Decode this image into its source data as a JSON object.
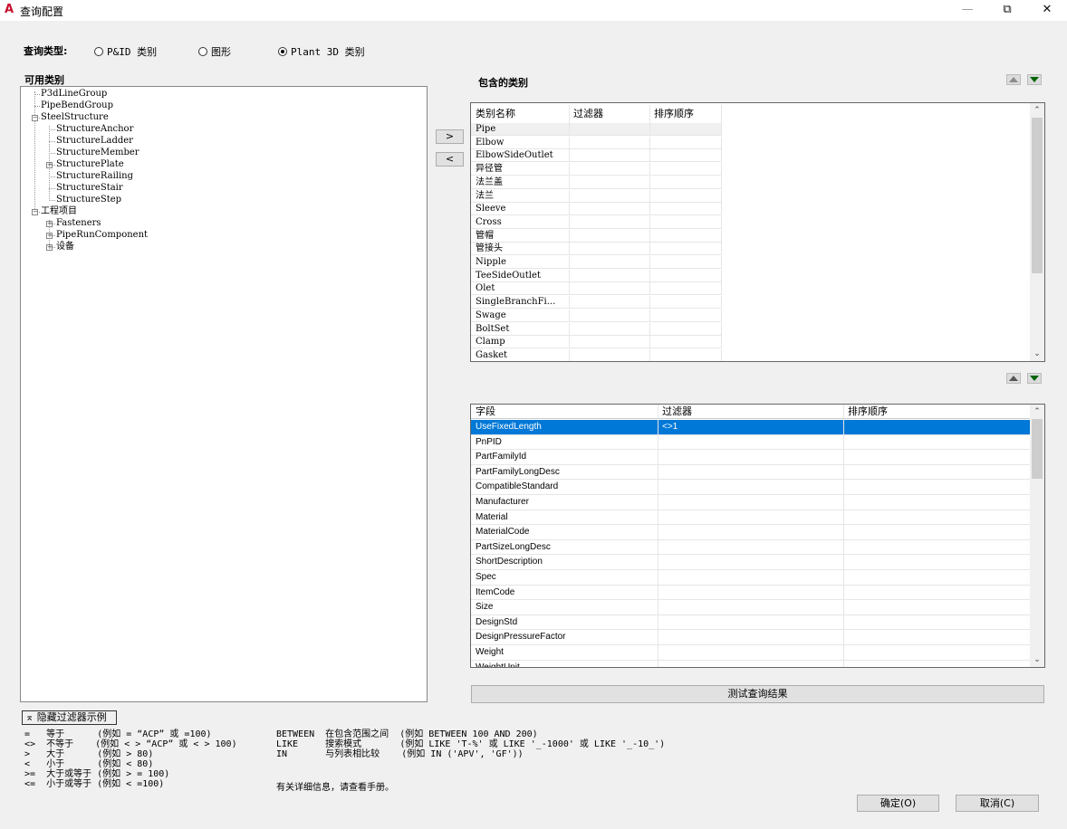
{
  "window": {
    "title": "查询配置",
    "app_icon": "A",
    "min_glyph": "—",
    "max_glyph": "⧉",
    "close_glyph": "✕"
  },
  "query_type": {
    "label": "查询类型:",
    "options": [
      {
        "label": "P&ID 类别",
        "selected": false
      },
      {
        "label": "图形",
        "selected": false
      },
      {
        "label": "Plant 3D 类别",
        "selected": true
      }
    ]
  },
  "available": {
    "title": "可用类别",
    "tree": [
      {
        "label": "P3dLineGroup",
        "level": 0,
        "expander": ""
      },
      {
        "label": "PipeBendGroup",
        "level": 0,
        "expander": ""
      },
      {
        "label": "SteelStructure",
        "level": 0,
        "expander": "−"
      },
      {
        "label": "StructureAnchor",
        "level": 1,
        "expander": ""
      },
      {
        "label": "StructureLadder",
        "level": 1,
        "expander": ""
      },
      {
        "label": "StructureMember",
        "level": 1,
        "expander": ""
      },
      {
        "label": "StructurePlate",
        "level": 1,
        "expander": "+"
      },
      {
        "label": "StructureRailing",
        "level": 1,
        "expander": ""
      },
      {
        "label": "StructureStair",
        "level": 1,
        "expander": ""
      },
      {
        "label": "StructureStep",
        "level": 1,
        "expander": ""
      },
      {
        "label": "工程项目",
        "level": 0,
        "expander": "−"
      },
      {
        "label": "Fasteners",
        "level": 1,
        "expander": "+"
      },
      {
        "label": "PipeRunComponent",
        "level": 1,
        "expander": "+"
      },
      {
        "label": "设备",
        "level": 1,
        "expander": "+"
      }
    ]
  },
  "move": {
    "add": ">",
    "remove": "<"
  },
  "included": {
    "title": "包含的类别",
    "columns": [
      "类别名称",
      "过滤器",
      "排序顺序"
    ],
    "rows": [
      "Pipe",
      "Elbow",
      "ElbowSideOutlet",
      "异径管",
      "法兰盖",
      "法兰",
      "Sleeve",
      "Cross",
      "管帽",
      "管接头",
      "Nipple",
      "TeeSideOutlet",
      "Olet",
      "SingleBranchFi...",
      "Swage",
      "BoltSet",
      "Clamp",
      "Gasket"
    ]
  },
  "fields": {
    "columns": [
      "字段",
      "过滤器",
      "排序顺序"
    ],
    "rows": [
      {
        "field": "UseFixedLength",
        "filter": "<>1",
        "sort": ""
      },
      {
        "field": "PnPID",
        "filter": "",
        "sort": ""
      },
      {
        "field": "PartFamilyId",
        "filter": "",
        "sort": ""
      },
      {
        "field": "PartFamilyLongDesc",
        "filter": "",
        "sort": ""
      },
      {
        "field": "CompatibleStandard",
        "filter": "",
        "sort": ""
      },
      {
        "field": "Manufacturer",
        "filter": "",
        "sort": ""
      },
      {
        "field": "Material",
        "filter": "",
        "sort": ""
      },
      {
        "field": "MaterialCode",
        "filter": "",
        "sort": ""
      },
      {
        "field": "PartSizeLongDesc",
        "filter": "",
        "sort": ""
      },
      {
        "field": "ShortDescription",
        "filter": "",
        "sort": ""
      },
      {
        "field": "Spec",
        "filter": "",
        "sort": ""
      },
      {
        "field": "ItemCode",
        "filter": "",
        "sort": ""
      },
      {
        "field": "Size",
        "filter": "",
        "sort": ""
      },
      {
        "field": "DesignStd",
        "filter": "",
        "sort": ""
      },
      {
        "field": "DesignPressureFactor",
        "filter": "",
        "sort": ""
      },
      {
        "field": "Weight",
        "filter": "",
        "sort": ""
      },
      {
        "field": "WeightUnit",
        "filter": "",
        "sort": ""
      }
    ]
  },
  "test_button": "测试查询结果",
  "hide_examples": "隐藏过滤器示例",
  "help": {
    "left": "=   等于      (例如 = “ACP” 或 =100)\n<>  不等于    (例如 < > “ACP” 或 < > 100)\n>   大于      (例如 > 80)\n<   小于      (例如 < 80)\n>=  大于或等于 (例如 > = 100)\n<=  小于或等于 (例如 < =100)",
    "right": "BETWEEN  在包含范围之间  (例如 BETWEEN 100 AND 200)\nLIKE     搜索模式       (例如 LIKE 'T-%' 或 LIKE '_-1000' 或 LIKE '_-10_')\nIN       与列表相比较    (例如 IN ('APV', 'GF'))",
    "more": "有关详细信息，请查看手册。"
  },
  "ok": "确定(O)",
  "cancel": "取消(C)"
}
